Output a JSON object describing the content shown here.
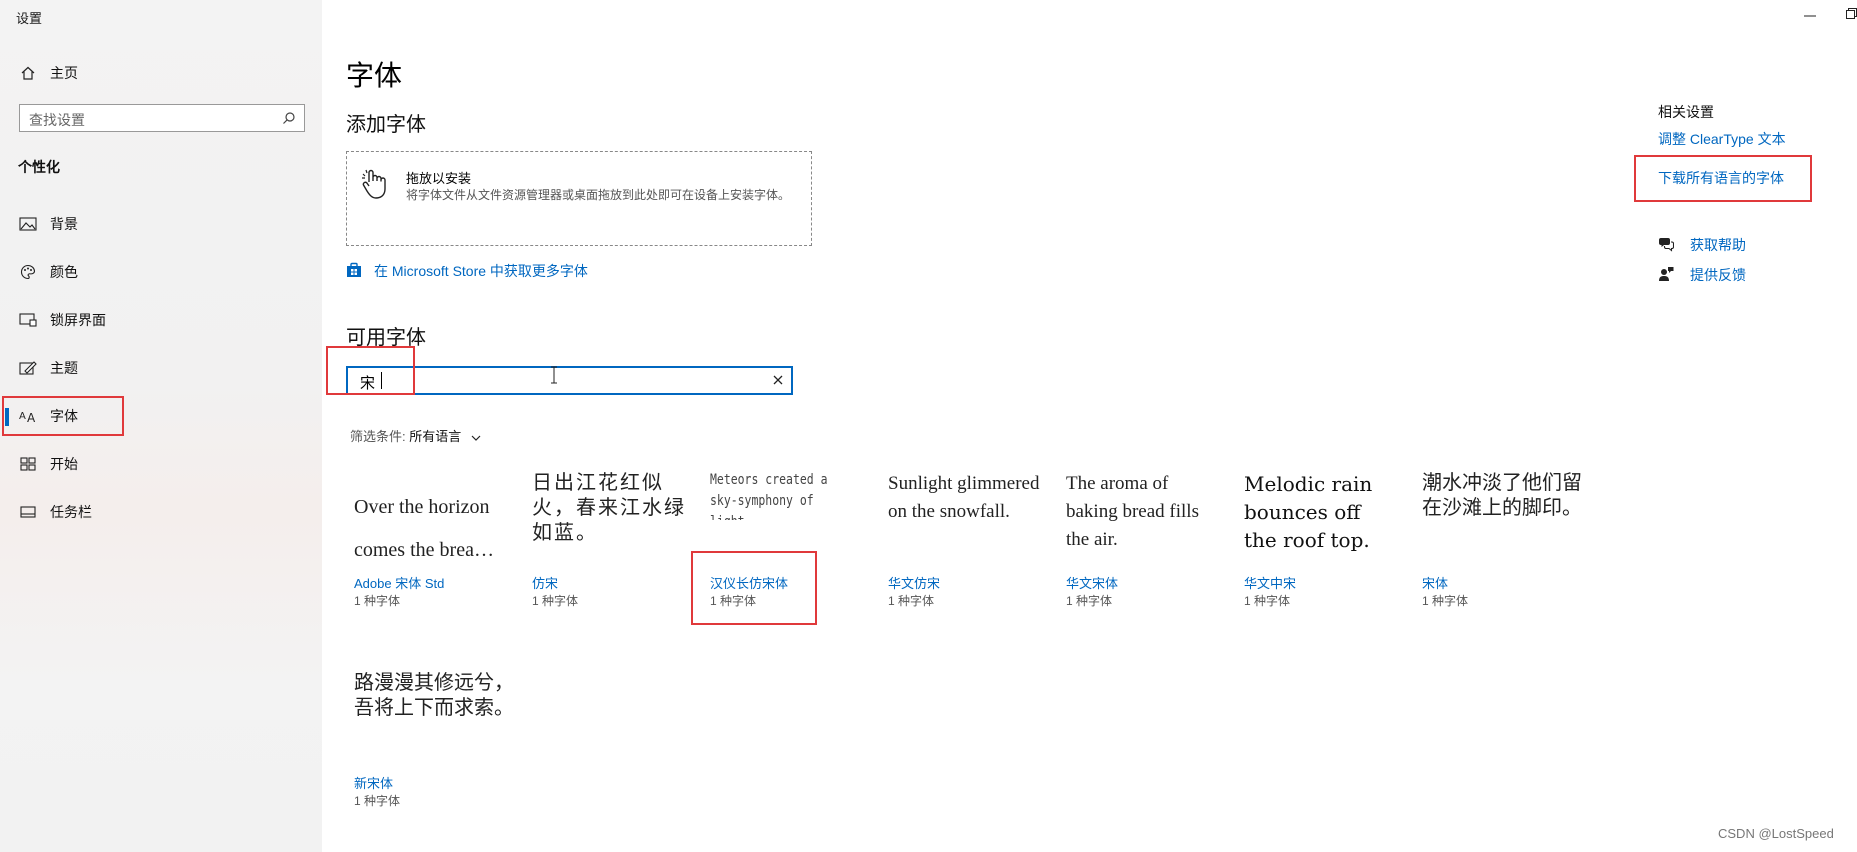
{
  "window": {
    "title": "设置"
  },
  "sidebar": {
    "home_label": "主页",
    "search_placeholder": "查找设置",
    "section_title": "个性化",
    "items": [
      {
        "label": "背景",
        "icon": "image-icon"
      },
      {
        "label": "颜色",
        "icon": "palette-icon"
      },
      {
        "label": "锁屏界面",
        "icon": "lock-screen-icon"
      },
      {
        "label": "主题",
        "icon": "theme-icon"
      },
      {
        "label": "字体",
        "icon": "font-icon",
        "selected": true
      },
      {
        "label": "开始",
        "icon": "start-icon"
      },
      {
        "label": "任务栏",
        "icon": "taskbar-icon"
      }
    ]
  },
  "main": {
    "title": "字体",
    "add_fonts_title": "添加字体",
    "drop_zone": {
      "title": "拖放以安装",
      "description": "将字体文件从文件资源管理器或桌面拖放到此处即可在设备上安装字体。"
    },
    "store_link": "在 Microsoft Store 中获取更多字体",
    "available_title": "可用字体",
    "search_value": "宋",
    "filter_label": "筛选条件:",
    "filter_value": "所有语言",
    "fonts": [
      {
        "sample": "Over the horizon comes the brea…",
        "name": "Adobe 宋体 Std",
        "count": "1 种字体"
      },
      {
        "sample": "日出江花红似火，春来江水绿如蓝。",
        "name": "仿宋",
        "count": "1 种字体"
      },
      {
        "sample": "Meteors created a sky-symphony of light.",
        "name": "汉仪长仿宋体",
        "count": "1 种字体"
      },
      {
        "sample": "Sunlight glimmered on the snowfall.",
        "name": "华文仿宋",
        "count": "1 种字体"
      },
      {
        "sample": "The aroma of baking bread fills the air.",
        "name": "华文宋体",
        "count": "1 种字体"
      },
      {
        "sample": "Melodic rain bounces off the roof top.",
        "name": "华文中宋",
        "count": "1 种字体"
      },
      {
        "sample": "潮水冲淡了他们留在沙滩上的脚印。",
        "name": "宋体",
        "count": "1 种字体"
      },
      {
        "sample": "路漫漫其修远兮，吾将上下而求索。",
        "name": "新宋体",
        "count": "1 种字体"
      }
    ]
  },
  "related": {
    "title": "相关设置",
    "links": [
      "调整 ClearType 文本",
      "下载所有语言的字体"
    ],
    "help": "获取帮助",
    "feedback": "提供反馈"
  },
  "watermark": "CSDN @LostSpeed",
  "colors": {
    "accent": "#0067c0",
    "highlight_box": "#e0393b"
  }
}
